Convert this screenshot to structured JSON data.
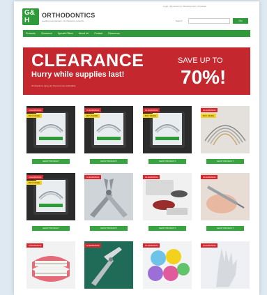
{
  "header": {
    "topbar_text": "Login  |  My Account  |  Shopping Cart  |  Checkout",
    "logo_line1": "G&",
    "logo_line2": "H",
    "brand": "ORTHODONTICS",
    "tagline": "Leading manufacturer of orthodontic products",
    "search_label": "Search",
    "search_placeholder": "",
    "search_button": "Go"
  },
  "nav": {
    "items": [
      "Products",
      "Clearance",
      "Special Offers",
      "About Us",
      "Contact",
      "Resources"
    ]
  },
  "banner": {
    "title": "CLEARANCE",
    "subtitle": "Hurry while supplies last!",
    "note": "All clearance sales are final and non-refundable.",
    "save_label": "SAVE UP TO",
    "save_percent": "70%!"
  },
  "products": [
    {
      "badge": "CLEARANCE",
      "badge2": "BUY MORE",
      "image": "wire-package",
      "button": "SHOP PRODUCT"
    },
    {
      "badge": "CLEARANCE",
      "badge2": "BUY MORE",
      "image": "wire-package",
      "button": "SHOP PRODUCT"
    },
    {
      "badge": "CLEARANCE",
      "badge2": "BUY MORE",
      "image": "wire-package",
      "button": "SHOP PRODUCT"
    },
    {
      "badge": "CLEARANCE",
      "badge2": "BUY MORE",
      "image": "archwires",
      "button": "SHOP PRODUCT"
    },
    {
      "badge": "CLEARANCE",
      "badge2": "BUY MORE",
      "image": "wire-package",
      "button": "SHOP PRODUCT"
    },
    {
      "badge": "CLEARANCE",
      "badge2": "",
      "image": "pliers",
      "button": "SHOP PRODUCT"
    },
    {
      "badge": "CLEARANCE",
      "badge2": "",
      "image": "elastics",
      "button": "SHOP PRODUCT"
    },
    {
      "badge": "CLEARANCE",
      "badge2": "",
      "image": "hand-instrument",
      "button": "SHOP PRODUCT"
    },
    {
      "badge": "CLEARANCE",
      "badge2": "",
      "image": "braces-model",
      "button": ""
    },
    {
      "badge": "CLEARANCE",
      "badge2": "",
      "image": "plier-green",
      "button": ""
    },
    {
      "badge": "CLEARANCE",
      "badge2": "",
      "image": "colored-cups",
      "button": ""
    },
    {
      "badge": "CLEARANCE",
      "badge2": "",
      "image": "gloved-hand",
      "button": ""
    }
  ],
  "colors": {
    "brand_green": "#2e9a3a",
    "banner_red": "#c4272d",
    "badge_red": "#d8262c",
    "badge_yellow": "#f2d21c"
  }
}
